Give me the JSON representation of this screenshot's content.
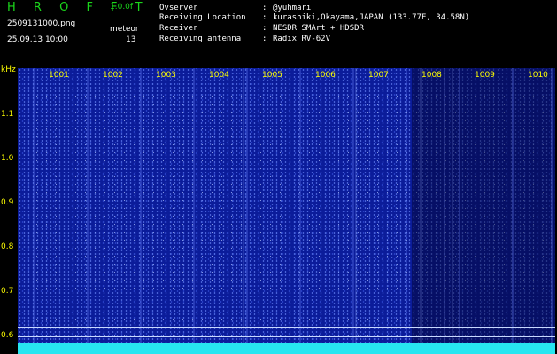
{
  "header": {
    "app_title": "H R O F F T",
    "app_version": "1.0.0f",
    "filename": "2509131000.png",
    "datetime": "25.09.13 10:00",
    "meteor_label": "meteor",
    "meteor_count": "13",
    "info": [
      {
        "label": "Ovserver",
        "value": "@yuhmari"
      },
      {
        "label": "Receiving Location",
        "value": "kurashiki,Okayama,JAPAN (133.77E, 34.58N)"
      },
      {
        "label": "Receiver",
        "value": "NESDR SMArt + HDSDR"
      },
      {
        "label": "Receiving antenna",
        "value": "Radix RV-62V"
      }
    ],
    "separator": ":"
  },
  "axis": {
    "unit": "kHz",
    "y_ticks": [
      "1.1",
      "1.0",
      "0.9",
      "0.8",
      "0.7",
      "0.6"
    ],
    "x_ticks": [
      "1001",
      "1002",
      "1003",
      "1004",
      "1005",
      "1006",
      "1007",
      "1008",
      "1009",
      "1010"
    ]
  },
  "colors": {
    "background": "#0b1c9a",
    "header_text": "#ffffff",
    "title": "#1bd61b",
    "axis": "#ffff00",
    "baseline": "#27e6f0"
  }
}
